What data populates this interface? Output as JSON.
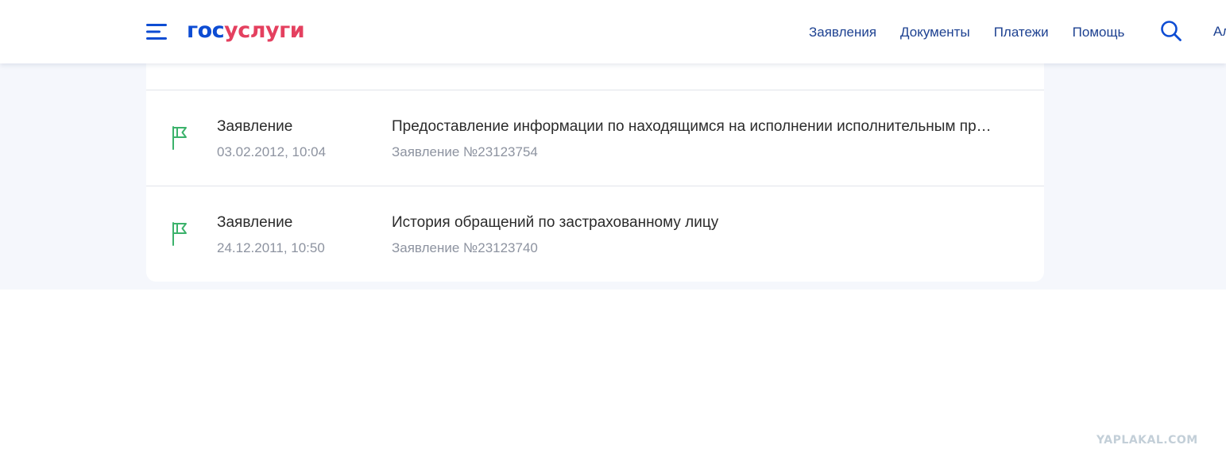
{
  "header": {
    "logo": {
      "part1": "гос",
      "part2": "услуги"
    },
    "nav": [
      "Заявления",
      "Документы",
      "Платежи",
      "Помощь"
    ],
    "user_cut": "Ал"
  },
  "list": {
    "items": [
      {
        "kind": "Заявление",
        "date": "03.02.2012, 10:04",
        "title": "Предоставление информации по находящимся на исполнении исполнительным производствам в отношении физического лица",
        "number": "Заявление №23123754"
      },
      {
        "kind": "Заявление",
        "date": "24.12.2011, 10:50",
        "title": "История обращений по застрахованному лицу",
        "number": "Заявление №23123740"
      }
    ]
  },
  "watermark": "YAPLAKAL.COM",
  "colors": {
    "brand_blue": "#0d4cd3",
    "brand_red": "#e4405f",
    "flag_green": "#3bb26b",
    "page_bg": "#f5f7fc"
  },
  "icons": [
    "menu-icon",
    "search-icon",
    "flag-icon"
  ]
}
